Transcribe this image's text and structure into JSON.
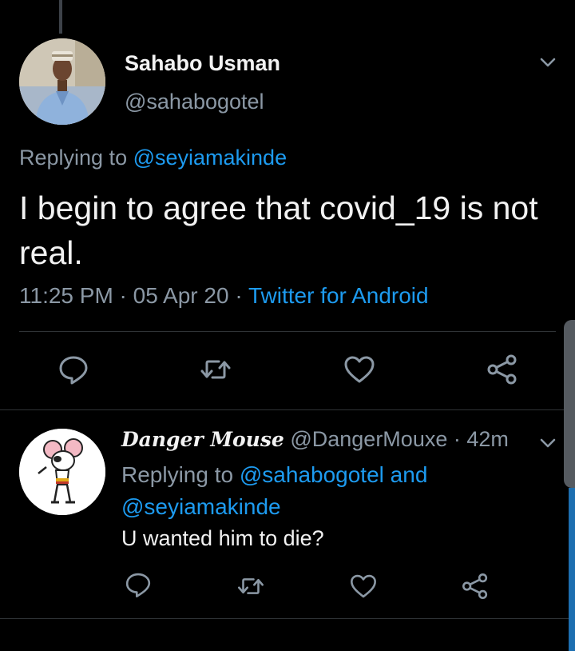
{
  "main_tweet": {
    "author_name": "Sahabo Usman",
    "author_handle": "@sahabogotel",
    "replying_prefix": "Replying to ",
    "replying_to": "@seyiamakinde",
    "text": "I begin to agree that covid_19 is not real.",
    "time": "11:25 PM",
    "separator": " · ",
    "date": "05 Apr 20",
    "source": "Twitter for Android"
  },
  "reply_tweet": {
    "author_name": "Danger Mouse",
    "author_handle": "@DangerMouxe",
    "separator": " · ",
    "age": "42m",
    "replying_prefix": "Replying to ",
    "replying_to_1": "@sahabogotel",
    "replying_joiner": " and ",
    "replying_to_2": "@seyiamakinde",
    "text": "U wanted him to die?"
  },
  "icons": {
    "reply": "reply-icon",
    "retweet": "retweet-icon",
    "like": "heart-icon",
    "share": "share-icon",
    "more": "chevron-down-icon"
  },
  "colors": {
    "background": "#000000",
    "link": "#1d9bf0",
    "secondary_text": "#8b98a5",
    "primary_text": "#f2f2f2"
  }
}
